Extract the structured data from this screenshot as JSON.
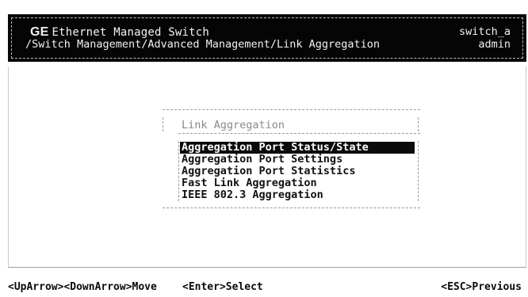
{
  "header": {
    "brand": "GE",
    "title": "Ethernet Managed Switch",
    "breadcrumb": "/Switch Management/Advanced Management/Link Aggregation",
    "hostname": "switch_a",
    "user": "admin"
  },
  "panel": {
    "title": "Link Aggregation",
    "items": [
      {
        "label": "Aggregation Port Status/State",
        "selected": true
      },
      {
        "label": "Aggregation Port Settings",
        "selected": false
      },
      {
        "label": "Aggregation Port Statistics",
        "selected": false
      },
      {
        "label": "Fast Link Aggregation",
        "selected": false
      },
      {
        "label": "IEEE 802.3 Aggregation",
        "selected": false
      }
    ]
  },
  "footer": {
    "move_hint": "<UpArrow><DownArrow>Move",
    "select_hint": "<Enter>Select",
    "previous_hint": "<ESC>Previous"
  },
  "colors": {
    "header_background": "#050505",
    "header_text": "#f2f2f2",
    "selection_background": "#0a0a0a",
    "selection_text": "#ffffff",
    "panel_title": "#8a8a8a"
  }
}
